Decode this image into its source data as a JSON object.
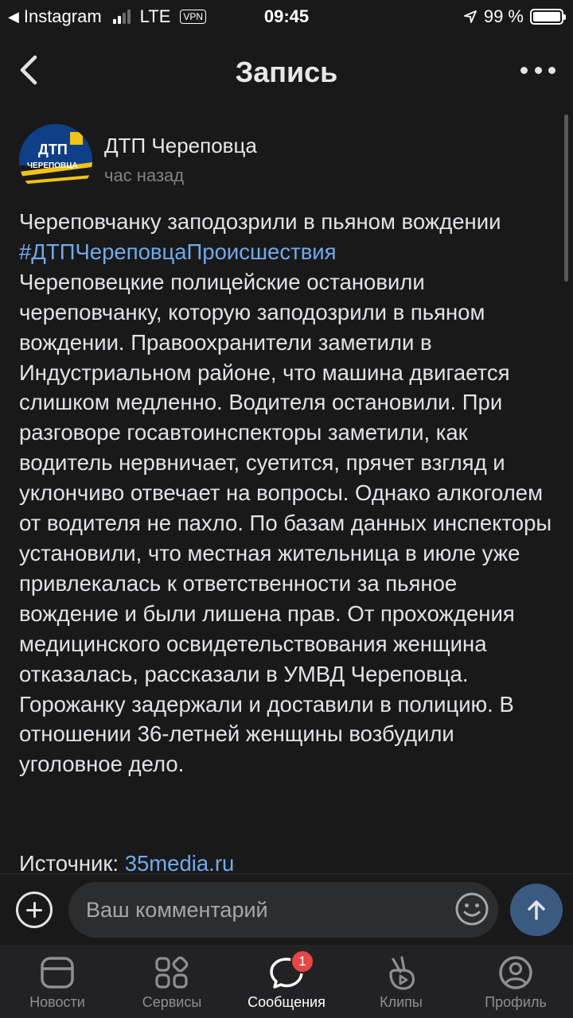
{
  "status_bar": {
    "back_app": "Instagram",
    "network": "LTE",
    "vpn": "VPN",
    "time": "09:45",
    "battery": "99 %",
    "battery_level": 0.99
  },
  "header": {
    "title": "Запись"
  },
  "post": {
    "author": "ДТП Череповца",
    "avatar_text_top": "ДТП",
    "avatar_text_bottom": "ЧЕРЕПОВЦА",
    "time": "час назад",
    "headline": "Череповчанку заподозрили в пьяном вождении",
    "hashtag": "#ДТПЧереповцаПроисшествия",
    "body": "Череповецкие полицейские остановили череповчанку, которую заподозрили в пьяном вождении. Правоохранители заметили в Индустриальном районе, что машина двигается слишком медленно. Водителя остановили. При разговоре госавтоинспекторы заметили, как водитель нервничает, суетится, прячет взгляд и уклончиво отвечает на вопросы. Однако алкоголем от водителя не пахло. По базам данных инспекторы установили, что местная жительница в июле уже привлекалась к ответственности за пьяное вождение и были лишена прав. От прохождения медицинского освидетельствования женщина отказалась, рассказали в УМВД Череповца. Горожанку задержали и доставили в полицию. В отношении 36-летней женщины возбудили уголовное дело.",
    "source_label": "Источник:",
    "source_link": "35media.ru"
  },
  "comment": {
    "placeholder": "Ваш комментарий"
  },
  "tabs": [
    {
      "label": "Новости",
      "icon": "news-icon"
    },
    {
      "label": "Сервисы",
      "icon": "services-icon"
    },
    {
      "label": "Сообщения",
      "icon": "messages-icon",
      "badge": "1",
      "active": true
    },
    {
      "label": "Клипы",
      "icon": "clips-icon"
    },
    {
      "label": "Профиль",
      "icon": "profile-icon"
    }
  ]
}
